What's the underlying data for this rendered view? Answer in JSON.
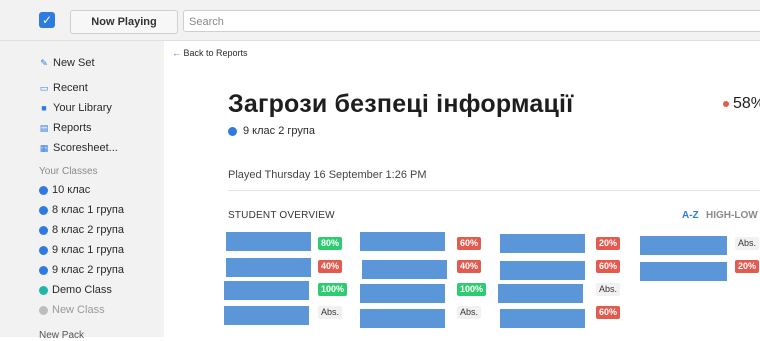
{
  "topbar": {
    "now_playing_label": "Now Playing",
    "search_placeholder": "Search"
  },
  "sidebar": {
    "new_set": "New Set",
    "recent": "Recent",
    "your_library": "Your Library",
    "reports": "Reports",
    "scoresheet": "Scoresheet...",
    "your_classes_heading": "Your Classes",
    "classes": [
      "10 клас",
      "8 клас 1 група",
      "8 клас 2 група",
      "9 клас 1 група",
      "9 клас 2 група",
      "Demo Class"
    ],
    "new_class": "New Class",
    "new_pack": "New Pack"
  },
  "main": {
    "back_link": "Back to Reports",
    "title": "Загрози безпеці інформації",
    "score": "58%",
    "class_name": "9 клас 2 група",
    "played": "Played Thursday 16 September 1:26 PM",
    "student_overview": "STUDENT OVERVIEW",
    "sort_az": "A-Z",
    "sort_high_low": "HIGH-LOW"
  },
  "results": [
    [
      "80%",
      "40%",
      "100%",
      "Abs."
    ],
    [
      "60%",
      "40%",
      "100%",
      "Abs."
    ],
    [
      "20%",
      "60%",
      "Abs.",
      "60%"
    ],
    [
      "Abs.",
      "20%"
    ]
  ],
  "colors": {
    "accent": "#2d7be0",
    "good": "#2ecc71",
    "bad": "#e35a4f",
    "bar": "#5b96d8"
  }
}
